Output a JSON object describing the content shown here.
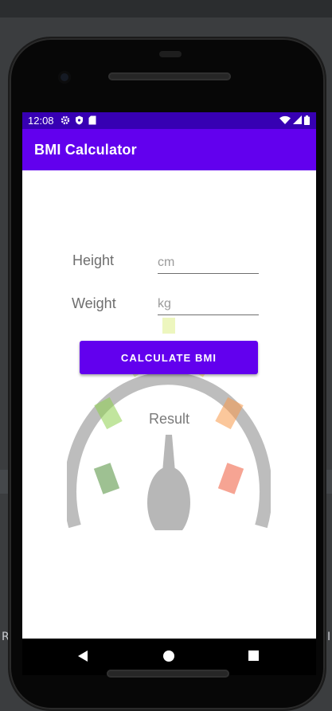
{
  "status_bar": {
    "time": "12:08"
  },
  "app": {
    "title": "BMI Calculator"
  },
  "form": {
    "height_label": "Height",
    "height_placeholder": "cm",
    "weight_label": "Weight",
    "weight_placeholder": "kg",
    "button_label": "CALCULATE BMI"
  },
  "result": {
    "text": "Result"
  },
  "ide": {
    "left_letter": "R",
    "right_letter": "I"
  },
  "colors": {
    "status_bar": "#3700b3",
    "app_bar": "#6200ee",
    "button": "#6200ee"
  },
  "icons": {
    "status_left": [
      "settings-icon",
      "shield-icon",
      "sd-card-icon"
    ],
    "status_right": [
      "wifi-icon",
      "signal-icon",
      "battery-icon"
    ],
    "nav": [
      "back-icon",
      "home-icon",
      "recents-icon"
    ]
  }
}
